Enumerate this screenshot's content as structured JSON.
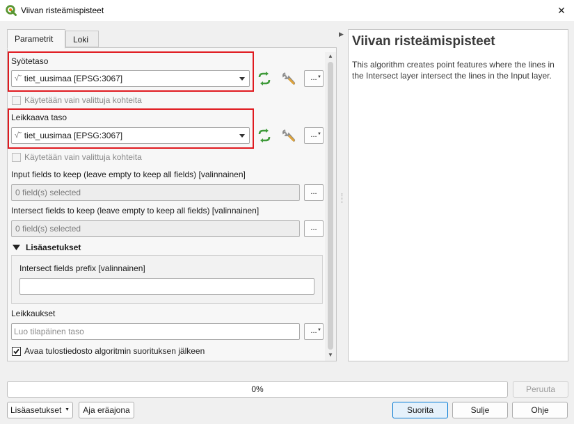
{
  "window": {
    "title": "Viivan risteämispisteet",
    "icon": "qgis-logo-icon",
    "close_glyph": "✕"
  },
  "tabs": [
    {
      "label": "Parametrit",
      "active": true
    },
    {
      "label": "Loki",
      "active": false
    }
  ],
  "params": {
    "input_layer": {
      "label": "Syötetaso",
      "value": "tiet_uusimaa [EPSG:3067]",
      "selected_only_label": "Käytetään vain valittuja kohteita"
    },
    "intersect_layer": {
      "label": "Leikkaava taso",
      "value": "tiet_uusimaa [EPSG:3067]",
      "selected_only_label": "Käytetään vain valittuja kohteita"
    },
    "input_fields": {
      "label": "Input fields to keep (leave empty to keep all fields) [valinnainen]",
      "value": "0 field(s) selected"
    },
    "intersect_fields": {
      "label": "Intersect fields to keep (leave empty to keep all fields) [valinnainen]",
      "value": "0 field(s) selected"
    },
    "advanced": {
      "label": "Lisäasetukset",
      "prefix_label": "Intersect fields prefix [valinnainen]",
      "prefix_value": ""
    },
    "output": {
      "label": "Leikkaukset",
      "placeholder": "Luo tilapäinen taso",
      "open_after_label": "Avaa tulostiedosto algoritmin suorituksen jälkeen",
      "open_after_checked": true
    },
    "more_button": "...",
    "line_layer_glyph": "√˜"
  },
  "help": {
    "title": "Viivan risteämispisteet",
    "text": "This algorithm creates point features where the lines in the Intersect layer intersect the lines in the Input layer."
  },
  "progress": {
    "value": 0,
    "label": "0%"
  },
  "buttons": {
    "cancel": "Peruuta",
    "advanced": "Lisäasetukset",
    "batch": "Aja eräajona",
    "run": "Suorita",
    "close": "Sulje",
    "help": "Ohje"
  },
  "colors": {
    "highlight_box": "#e0191f",
    "iterate_icon": "#3f9a3a",
    "progress": "#06b025",
    "default_button_border": "#0078d4"
  }
}
